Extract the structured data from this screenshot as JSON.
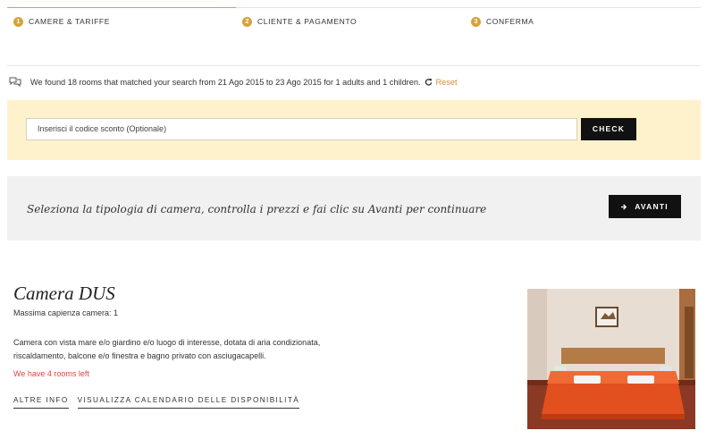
{
  "steps": [
    {
      "num": "1",
      "label": "CAMERE & TARIFFE",
      "active": true
    },
    {
      "num": "2",
      "label": "CLIENTE & PAGAMENTO",
      "active": false
    },
    {
      "num": "3",
      "label": "CONFERMA",
      "active": false
    }
  ],
  "search": {
    "message": "We found 18 rooms that matched your search from 21 Ago 2015 to 23 Ago 2015 for 1 adults and 1 children.",
    "reset_label": "Reset",
    "accent": "#d98b3a"
  },
  "coupon": {
    "placeholder": "Inserisci il codice sconto (Optionale)",
    "check_label": "CHECK",
    "bg": "#fdf2cc"
  },
  "select": {
    "message": "Seleziona la tipologia di camera, controlla i prezzi e fai clic su Avanti per continuare",
    "avanti_label": "AVANTI"
  },
  "room": {
    "title": "Camera DUS",
    "capacity": "Massima capienza camera: 1",
    "description": "Camera con vista mare e/o giardino e/o luogo di interesse, dotata di aria condizionata, riscaldamento, balcone e/o finestra e bagno privato con asciugacapelli.",
    "availability": "We have 4 rooms left",
    "links": {
      "info": "ALTRE INFO",
      "calendar": "VISUALIZZA CALENDARIO DELLE DISPONIBILITÀ"
    }
  },
  "icons": {
    "chat": "chat-bubbles-icon",
    "reset": "refresh-icon",
    "avanti": "arrow-right-icon"
  },
  "colors": {
    "step_accent": "#d7a23a",
    "alert": "#e04545",
    "button": "#111111"
  }
}
